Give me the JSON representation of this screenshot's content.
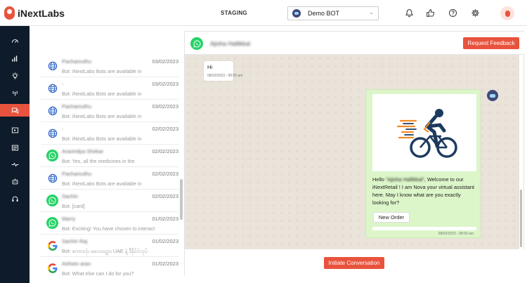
{
  "app": {
    "name": "iNextLabs",
    "environment": "STAGING"
  },
  "bot_selector": {
    "selected": "Demo BOT",
    "chevron_icon": "chevron-down-icon"
  },
  "header_icons": [
    "bell-icon",
    "thumbs-up-icon",
    "help-icon",
    "gear-icon",
    "profile-icon"
  ],
  "sidebar": {
    "items": [
      {
        "icon": "dashboard-icon",
        "active": false
      },
      {
        "icon": "analytics-icon",
        "active": false
      },
      {
        "icon": "bulb-icon",
        "active": false
      },
      {
        "icon": "broadcast-icon",
        "active": false
      },
      {
        "icon": "conversations-icon",
        "active": true
      },
      {
        "icon": "media-icon",
        "active": false
      },
      {
        "icon": "template-icon",
        "active": false
      },
      {
        "icon": "pulse-icon",
        "active": false
      },
      {
        "icon": "bot-icon",
        "active": false
      },
      {
        "icon": "headset-icon",
        "active": false
      }
    ]
  },
  "conversations": [
    {
      "channel": "web",
      "name": "Pachamuthu",
      "date": "03/02/2023",
      "preview": "Bot: iNextLabs Bots are available in"
    },
    {
      "channel": "web",
      "name": "-",
      "date": "03/02/2023",
      "preview": "Bot: iNextLabs Bots are available in"
    },
    {
      "channel": "web",
      "name": "Pachamuthu",
      "date": "03/02/2023",
      "preview": "Bot: iNextLabs Bots are available in"
    },
    {
      "channel": "web",
      "name": "-",
      "date": "02/02/2023",
      "preview": "Bot: iNextLabs Bots are available in"
    },
    {
      "channel": "whatsapp",
      "name": "Aravindya Shekar",
      "date": "02/02/2023",
      "preview": "Bot: Yes, all the medicines in the"
    },
    {
      "channel": "web",
      "name": "Pachamuthu",
      "date": "02/02/2023",
      "preview": "Bot: iNextLabs Bots are available in"
    },
    {
      "channel": "whatsapp",
      "name": "Sachin",
      "date": "02/02/2023",
      "preview": "Bot: [card]"
    },
    {
      "channel": "whatsapp",
      "name": "Marry",
      "date": "01/02/2023",
      "preview": "Bot: Exciting! You have chosen to interact"
    },
    {
      "channel": "google",
      "name": "Sachin Raj",
      "date": "01/02/2023",
      "preview": "Bot: စကားလုံး မလေးသျှား UAE နဲ့ ဒီနိုင်ငံလုပ်"
    },
    {
      "channel": "google",
      "name": "Ashwin aran",
      "date": "01/02/2023",
      "preview": "Bot: What else can I do for you?"
    }
  ],
  "chat": {
    "contact_name": "Ajisha Hallikkal",
    "request_feedback_label": "Request Feedback",
    "user_message": {
      "text": "Hi",
      "time": "08/02/2023 - 08:50 am"
    },
    "bot_message": {
      "text_before": "Hello ",
      "name": "\"Ajisha Hallikkal\"",
      "text_after": ", Welcome to our iNextRetail ! I am Nova your virtual assistant here. May I know what are you exactly looking for?",
      "button_label": "New Order",
      "time": "08/02/2023 - 08:50 am"
    },
    "initiate_label": "Initiate Conversation"
  },
  "colors": {
    "accent": "#e8533d",
    "sidebar_bg": "#0d1b2a",
    "whatsapp": "#25d366",
    "bot_bubble": "#dcf5c9"
  }
}
